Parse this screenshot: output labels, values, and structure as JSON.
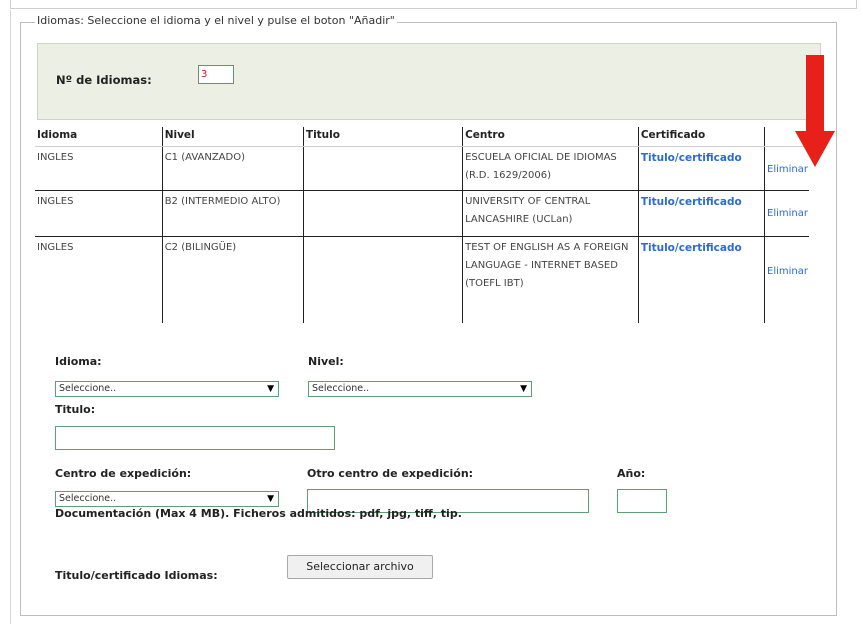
{
  "section": {
    "legend": "Idiomas: Seleccione el idioma y el nivel y pulse el boton \"Añadir\"",
    "count_label": "Nº de Idiomas:",
    "count_value": "3"
  },
  "table": {
    "headers": [
      "Idioma",
      "Nivel",
      "Titulo",
      "Centro",
      "Certificado"
    ],
    "rows": [
      {
        "idioma": "INGLES",
        "nivel": "C1 (AVANZADO)",
        "titulo": "",
        "centro": "ESCUELA OFICIAL DE IDIOMAS (R.D. 1629/2006)",
        "certificado": "Titulo/certificado",
        "accion": "Eliminar"
      },
      {
        "idioma": "INGLES",
        "nivel": "B2 (INTERMEDIO ALTO)",
        "titulo": "",
        "centro": "UNIVERSITY OF CENTRAL LANCASHIRE (UCLan)",
        "certificado": "Titulo/certificado",
        "accion": "Eliminar"
      },
      {
        "idioma": "INGLES",
        "nivel": "C2 (BILINGÜE)",
        "titulo": "",
        "centro": "TEST OF ENGLISH AS A FOREIGN LANGUAGE - INTERNET BASED (TOEFL IBT)",
        "certificado": "Titulo/certificado",
        "accion": "Eliminar"
      }
    ]
  },
  "form": {
    "idioma_label": "Idioma:",
    "idioma_value": "Seleccione..",
    "nivel_label": "Nivel:",
    "nivel_value": "Seleccione..",
    "titulo_label": "Titulo:",
    "centro_label": "Centro de expedición:",
    "centro_value": "Seleccione..",
    "otro_centro_label": "Otro centro de expedición:",
    "anio_label": "Año:",
    "doc_note": "Documentación (Max 4 MB). Ficheros admitidos: pdf, jpg, tiff, tip.",
    "file_label": "Titulo/certificado Idiomas:",
    "file_button": "Seleccionar archivo",
    "dropdown_arrow": "▼"
  },
  "colors": {
    "panel_bg": "#ecefe4",
    "link": "#2a6bd6",
    "input_border": "#5aa072",
    "annotation_arrow": "#e8201a"
  },
  "icons": {
    "annotation": "red-down-arrow-icon",
    "dropdown": "chevron-down-icon"
  }
}
